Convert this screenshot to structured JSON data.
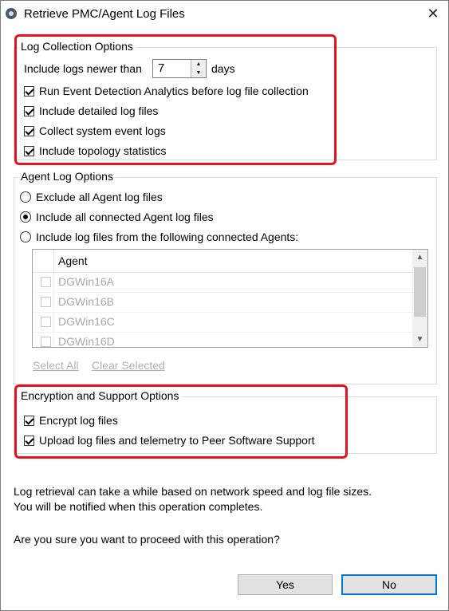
{
  "window": {
    "title": "Retrieve PMC/Agent Log Files",
    "close_glyph": "✕"
  },
  "log_collection": {
    "legend": "Log Collection Options",
    "include_logs_label": "Include logs newer than",
    "days_value": "7",
    "days_label": "days",
    "spin_up_glyph": "▲",
    "spin_down_glyph": "▼",
    "options": [
      {
        "label": "Run Event Detection Analytics before log file collection",
        "checked": true
      },
      {
        "label": "Include detailed log files",
        "checked": true
      },
      {
        "label": "Collect system event logs",
        "checked": true
      },
      {
        "label": "Include topology statistics",
        "checked": true
      }
    ]
  },
  "agent_log": {
    "legend": "Agent Log Options",
    "radios": [
      {
        "label": "Exclude all Agent log files",
        "selected": false
      },
      {
        "label": "Include all connected Agent log files",
        "selected": true
      },
      {
        "label": "Include log files from the following connected Agents:",
        "selected": false
      }
    ],
    "table_header": "Agent",
    "agents": [
      "DGWin16A",
      "DGWin16B",
      "DGWin16C",
      "DGWin16D"
    ],
    "scroll_up_glyph": "▲",
    "scroll_down_glyph": "▼",
    "select_all": "Select All",
    "clear_selected": "Clear Selected"
  },
  "encryption": {
    "legend": "Encryption and Support Options",
    "options": [
      {
        "label": "Encrypt log files",
        "checked": true
      },
      {
        "label": "Upload log files and telemetry to Peer Software Support",
        "checked": true
      }
    ]
  },
  "message": {
    "line1": "Log retrieval can take a while based on network speed and log file sizes.",
    "line2": "You will be notified when this operation completes.",
    "question": "Are you sure you want to proceed with this operation?"
  },
  "buttons": {
    "yes": "Yes",
    "no": "No"
  },
  "colors": {
    "highlight": "#e8101e",
    "default_button_border": "#0078d7",
    "disabled_text": "#b0b0b0"
  }
}
